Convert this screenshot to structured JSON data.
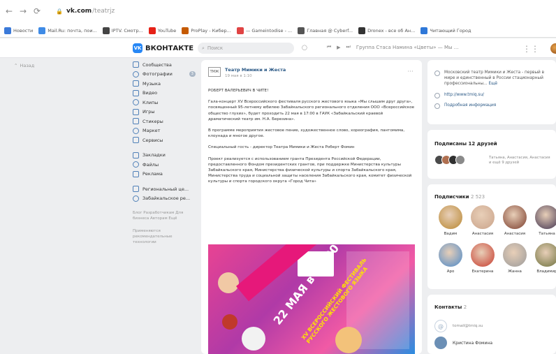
{
  "browser": {
    "url_domain": "vk.com",
    "url_path": "/teatrjz",
    "bookmarks": [
      {
        "label": "Новости",
        "color": "#3b7ad9"
      },
      {
        "label": "Mail.Ru: почта, пои...",
        "color": "#3f8be6"
      },
      {
        "label": "IPTV. Смотр...",
        "color": "#444444"
      },
      {
        "label": "YouTube",
        "color": "#e62117"
      },
      {
        "label": "ProPlay - Кибер...",
        "color": "#c55a00"
      },
      {
        "label": "— Gameintodise - ...",
        "color": "#e04444"
      },
      {
        "label": "Главная @ Cyberf...",
        "color": "#555555"
      },
      {
        "label": "Dronex - все об Ан...",
        "color": "#333333"
      },
      {
        "label": "Читающий Город",
        "color": "#2f78d8"
      }
    ]
  },
  "vk": {
    "brand": "ВКОНТАКТЕ",
    "logo_letters": "VK",
    "search_placeholder": "Поиск",
    "player_text": "Группа Стаса Намина «Цветы» — Мы ...",
    "back_label": "Назад"
  },
  "left_nav": {
    "group1": [
      {
        "label": "Сообщества",
        "icon": "community-icon"
      },
      {
        "label": "Фотографии",
        "icon": "photo-icon",
        "badge": "3"
      },
      {
        "label": "Музыка",
        "icon": "music-icon"
      },
      {
        "label": "Видео",
        "icon": "video-icon"
      },
      {
        "label": "Клипы",
        "icon": "clips-icon"
      },
      {
        "label": "Игры",
        "icon": "games-icon"
      },
      {
        "label": "Стикеры",
        "icon": "stickers-icon"
      },
      {
        "label": "Маркет",
        "icon": "market-icon"
      },
      {
        "label": "Сервисы",
        "icon": "services-icon"
      }
    ],
    "group2": [
      {
        "label": "Закладки",
        "icon": "bookmark-icon"
      },
      {
        "label": "Файлы",
        "icon": "files-icon"
      },
      {
        "label": "Реклама",
        "icon": "ads-icon"
      }
    ],
    "group3": [
      {
        "label": "Региональный це...",
        "icon": "region-icon"
      },
      {
        "label": "Забайкальское ре...",
        "icon": "region-icon"
      }
    ],
    "footer1": "Блог Разработчикам Для бизнеса Авторам Ещё",
    "footer2": "Применяются рекомендательные технологии"
  },
  "post": {
    "author": "Театр Мимики и Жеста",
    "date": "19 мая в 1:10",
    "logo_text": "ТМЖ",
    "paragraphs": [
      "РОБЕРТ ВАЛЕРЬЕВИЧ В ЧИТЕ!",
      "Гала-концерт XV Всероссийского фестиваля русского жестового языка «Мы слышим друг друга», посвященный 95-летнему юбилею Забайкальского регионального отделения ООО «Всероссийское общество глухих», будет проходить 22 мая в 17:00 в ГАУК «Забайкальский краевой драматический театр им. Н.А. Березина».",
      "В программе мероприятия жестовое пение, художественное слово, хореография, пантомима, клоунада и многое другое.",
      "Специальный гость - директор Театра Мимики и Жеста Роберт Фомин",
      "Проект реализуется с использованием гранта Президента Российской Федерации, предоставленного Фондом президентских грантов, при поддержке Министерства культуры Забайкальского края, Министерства физической культуры и спорта Забайкальского края, Министерства труда и социальной защиты населения Забайкальского края, комитет физической культуры и спорта городского округа «Город Чита»"
    ],
    "image": {
      "date_text": "22 МАЯ в 17:00",
      "title_text": "XV ВСЕРОССИЙСКИЙ ФЕСТИВАЛЬ РУССКОГО ЖЕСТОВОГО ЯЗЫКА"
    }
  },
  "info_card": {
    "description": "Московский театр Мимики и Жеста - первый в мире и единственный в России стационарный профессиональны...",
    "more": "Ещё",
    "website": "http://www.tmiq.su/",
    "details": "Подробная информация"
  },
  "friends_card": {
    "title": "Подписаны 12 друзей",
    "names": "Татьяна, Анастасия, Анастасия и ещё 9 друзей"
  },
  "subscribers_card": {
    "title": "Подписчики",
    "count": "2 523",
    "items": [
      {
        "name": "Вадим",
        "color": "#b8862f"
      },
      {
        "name": "Анастасия",
        "color": "#caa38a"
      },
      {
        "name": "Анастасия",
        "color": "#7a3b2b"
      },
      {
        "name": "Татьяна",
        "color": "#3c2f4d"
      },
      {
        "name": "Аро",
        "color": "#4a88c9"
      },
      {
        "name": "Екатерина",
        "color": "#c73a2d"
      },
      {
        "name": "Жанна",
        "color": "#9a9a9a"
      },
      {
        "name": "Владимир",
        "color": "#6a6f3a"
      }
    ]
  },
  "contacts_card": {
    "title": "Контакты",
    "count": "2",
    "email": "tomail@tmiq.su",
    "person": "Кристина Фомина"
  }
}
